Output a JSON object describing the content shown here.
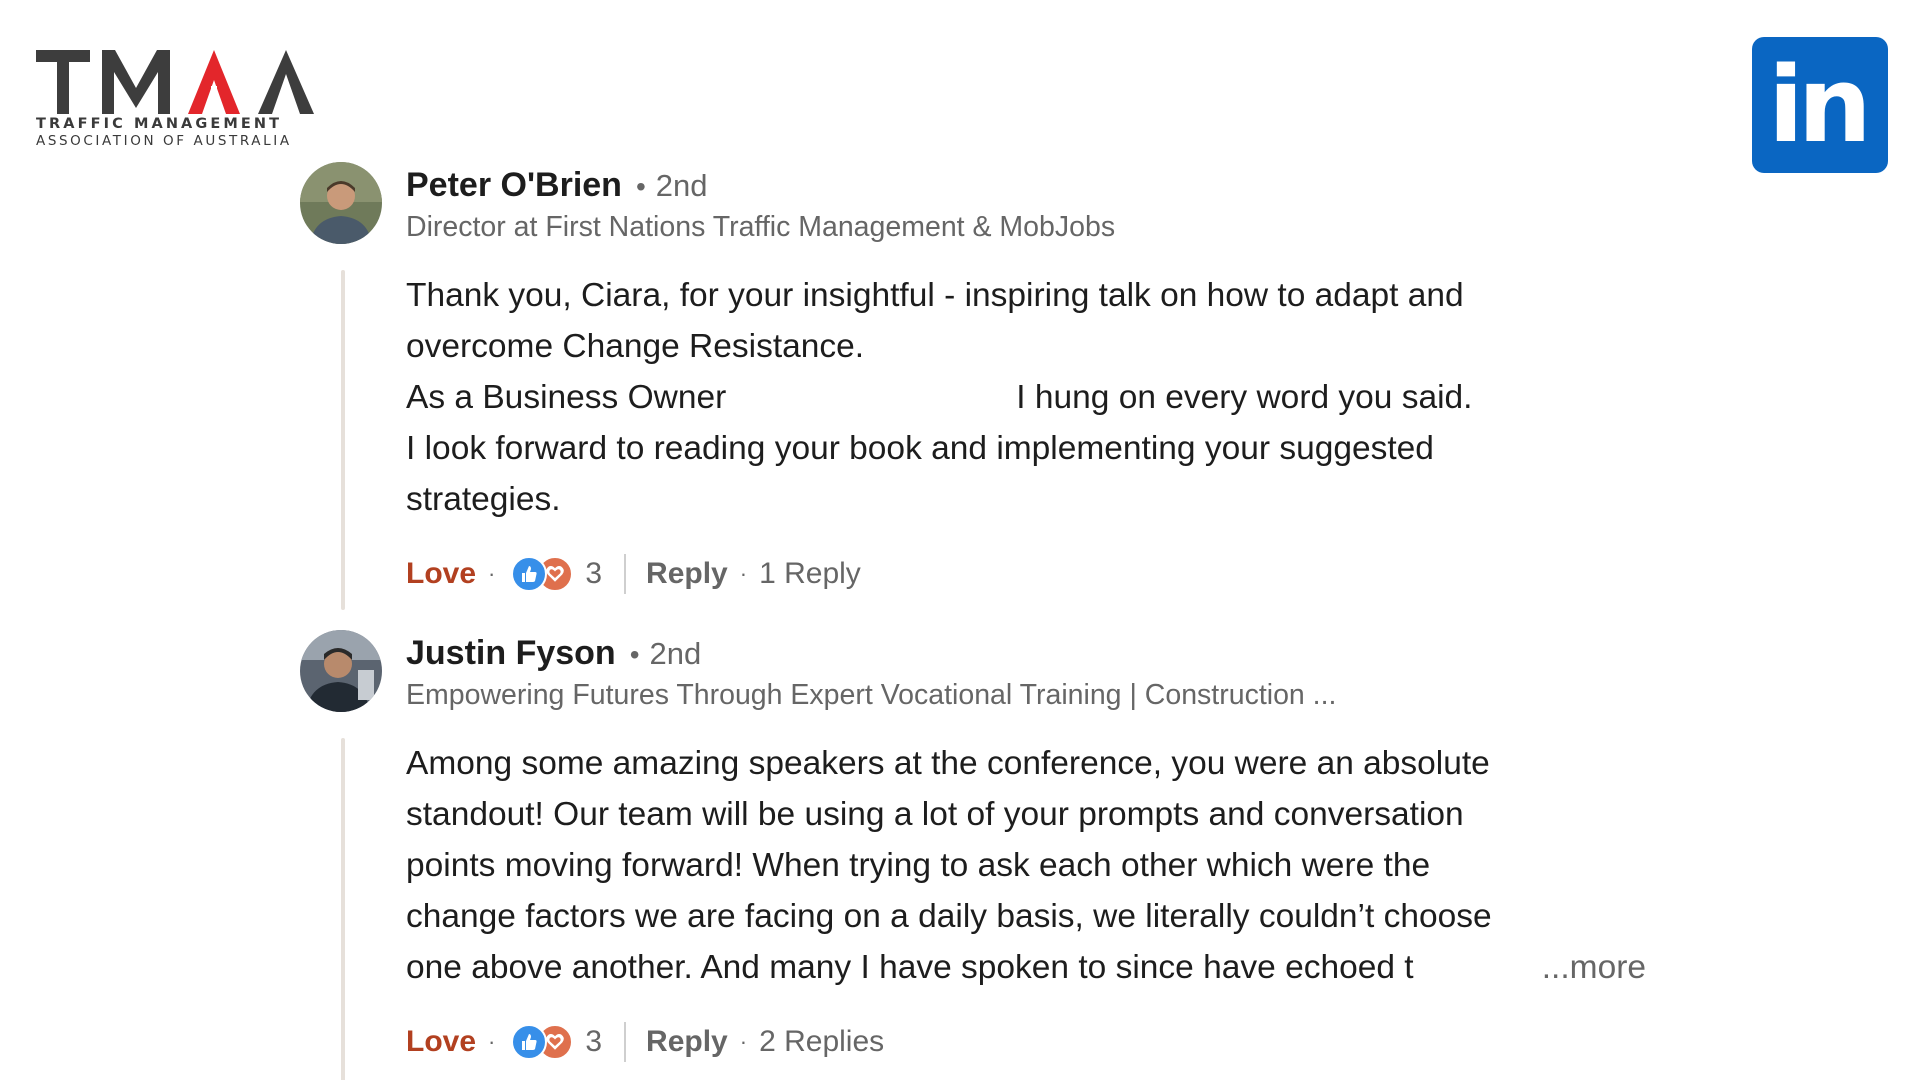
{
  "logo": {
    "letters": "TMAA",
    "line1": "TRAFFIC MANAGEMENT",
    "line2": "ASSOCIATION OF AUSTRALIA"
  },
  "linkedin_badge": {
    "text": "in",
    "color": "#0a66c2"
  },
  "comments": [
    {
      "author": "Peter O'Brien",
      "separator": "•",
      "degree": "2nd",
      "headline": "Director at First Nations Traffic Management & MobJobs",
      "lines": [
        "Thank you, Ciara, for your insightful - inspiring talk on how to adapt and",
        "overcome Change Resistance.",
        "As a Business Owner",
        "I hung on every word you said.",
        "I look forward to reading your book and implementing your suggested",
        "strategies."
      ],
      "more": "",
      "love_label": "Love",
      "dot": "·",
      "reaction_icons": [
        "like-reaction-icon",
        "love-reaction-icon"
      ],
      "reaction_count": "3",
      "reply_label": "Reply",
      "replies_label": "1 Reply"
    },
    {
      "author": "Justin Fyson",
      "separator": "•",
      "degree": "2nd",
      "headline": "Empowering Futures Through Expert Vocational Training | Construction ...",
      "lines": [
        "Among some amazing speakers at the conference, you were an absolute",
        "standout! Our team will be using a lot of your prompts and conversation",
        "points moving forward! When trying to ask each other which were the",
        "change factors we are facing on a daily basis, we literally couldn’t choose",
        "one above another. And many I have spoken to since have echoed t"
      ],
      "more": "...more",
      "love_label": "Love",
      "dot": "·",
      "reaction_icons": [
        "like-reaction-icon",
        "love-reaction-icon"
      ],
      "reaction_count": "3",
      "reply_label": "Reply",
      "replies_label": "2 Replies"
    }
  ],
  "colors": {
    "love": "#b24020",
    "muted": "#666666",
    "like_reaction": "#378fe9",
    "love_reaction": "#df704d",
    "logo_red": "#e3262b",
    "logo_dark": "#3d3d3d"
  }
}
